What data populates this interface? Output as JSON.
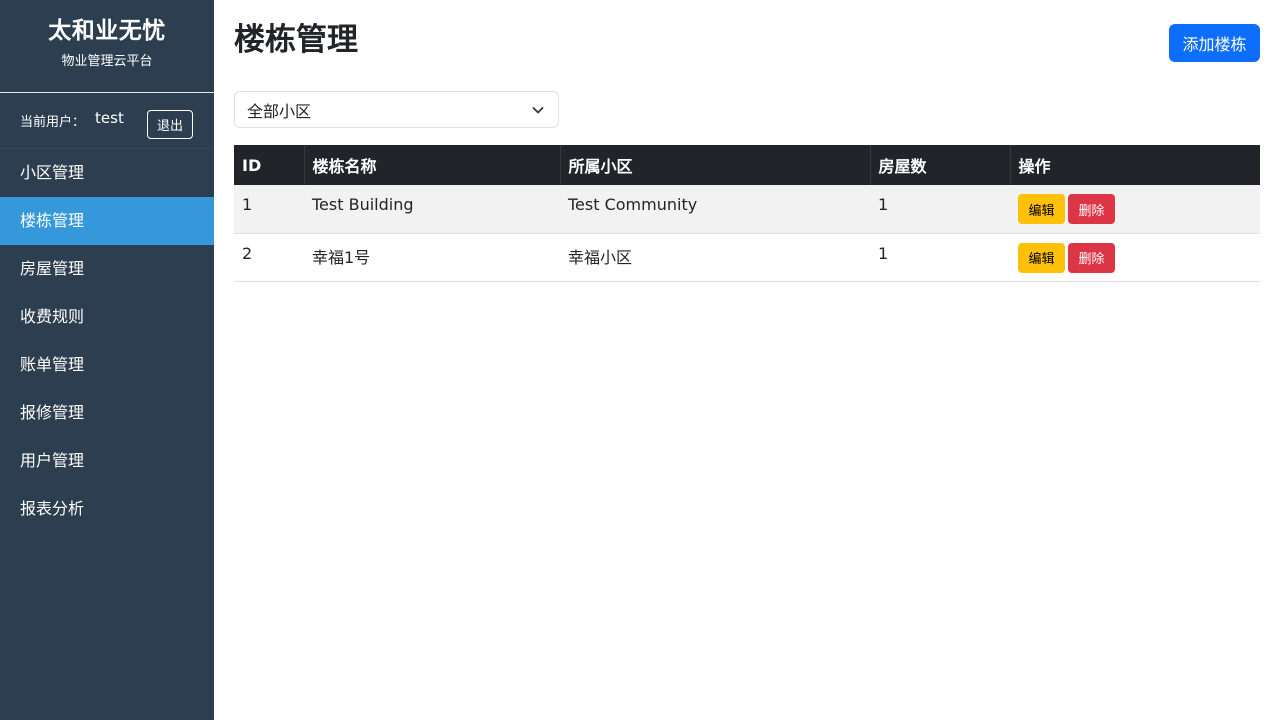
{
  "sidebar": {
    "brand_title": "太和业无忧",
    "brand_subtitle": "物业管理云平台",
    "user_label": "当前用户：",
    "user_name": "test",
    "logout_label": "退出",
    "items": [
      {
        "label": "小区管理"
      },
      {
        "label": "楼栋管理",
        "active": true
      },
      {
        "label": "房屋管理"
      },
      {
        "label": "收费规则"
      },
      {
        "label": "账单管理"
      },
      {
        "label": "报修管理"
      },
      {
        "label": "用户管理"
      },
      {
        "label": "报表分析"
      }
    ]
  },
  "header": {
    "title": "楼栋管理",
    "add_button": "添加楼栋"
  },
  "filter": {
    "selected": "全部小区"
  },
  "table": {
    "headers": [
      "ID",
      "楼栋名称",
      "所属小区",
      "房屋数",
      "操作"
    ],
    "rows": [
      {
        "id": "1",
        "name": "Test Building",
        "community": "Test Community",
        "houses": "1"
      },
      {
        "id": "2",
        "name": "幸福1号",
        "community": "幸福小区",
        "houses": "1"
      }
    ],
    "edit_label": "编辑",
    "delete_label": "删除"
  },
  "colors": {
    "sidebar_bg": "#2c3e50",
    "sidebar_active": "#3498db",
    "primary": "#0d6efd",
    "warning": "#ffc107",
    "danger": "#dc3545",
    "table_header": "#212529"
  },
  "icons": {
    "filter_chevron": "chevron-down-icon"
  }
}
